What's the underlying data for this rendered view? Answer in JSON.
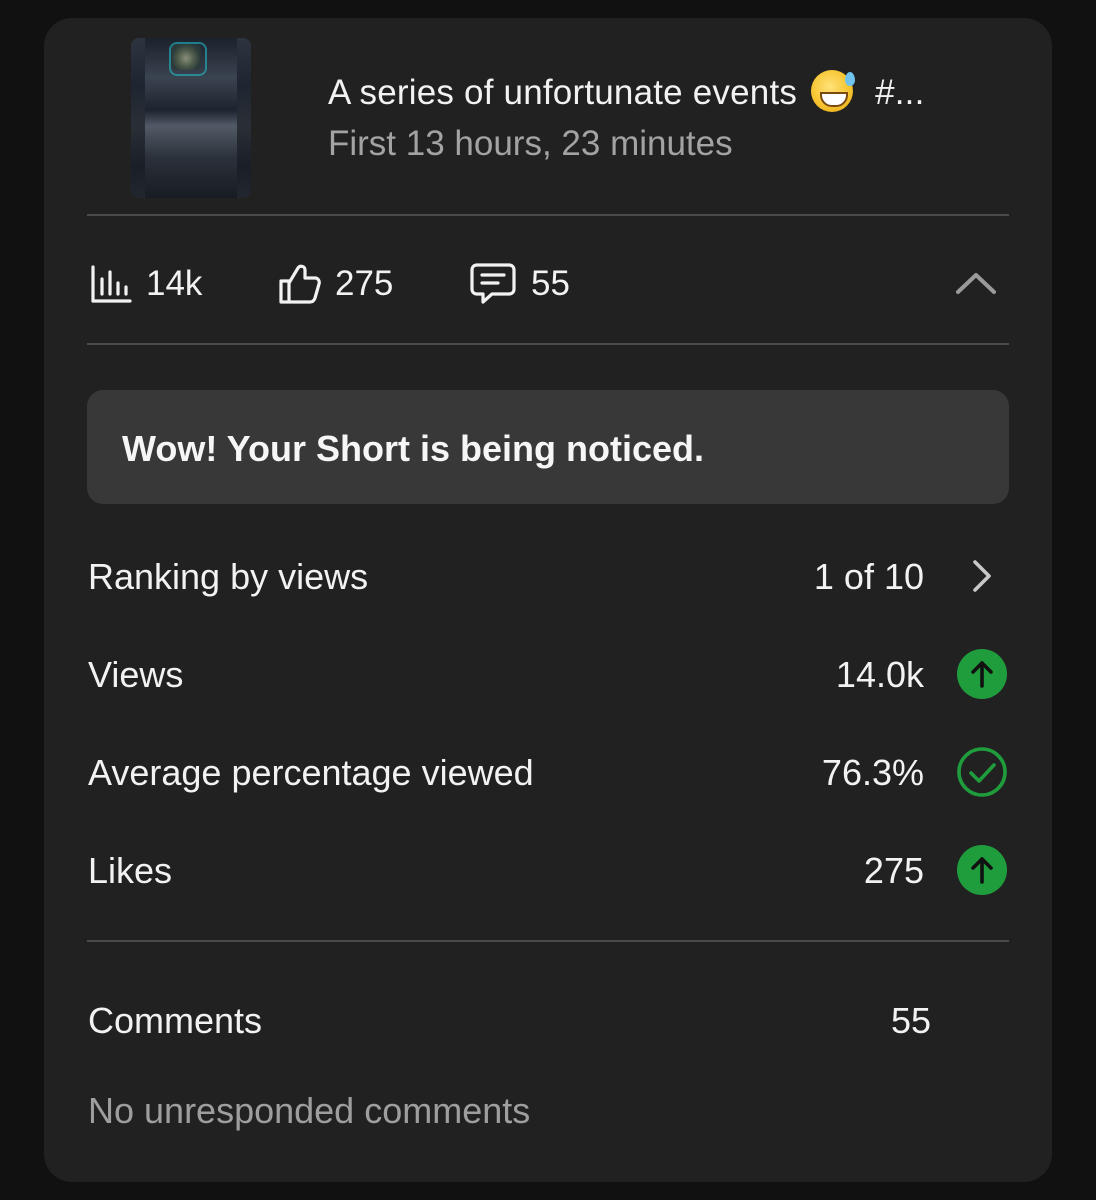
{
  "video": {
    "title": "A series of unfortunate events",
    "title_tail": "#...",
    "emoji": "grinning-face-with-sweat",
    "period": "First 13 hours, 23 minutes"
  },
  "summary": {
    "views": "14k",
    "likes": "275",
    "comments": "55"
  },
  "banner": {
    "text": "Wow! Your Short is being noticed."
  },
  "metrics": [
    {
      "label": "Ranking by views",
      "value": "1 of 10",
      "icon": "chevron-right-icon"
    },
    {
      "label": "Views",
      "value": "14.0k",
      "icon": "arrow-up-circle-icon"
    },
    {
      "label": "Average percentage viewed",
      "value": "76.3%",
      "icon": "check-circle-icon"
    },
    {
      "label": "Likes",
      "value": "275",
      "icon": "arrow-up-circle-icon"
    }
  ],
  "comments_section": {
    "label": "Comments",
    "value": "55",
    "status": "No unresponded comments"
  },
  "colors": {
    "background": "#111111",
    "card": "#212121",
    "banner": "#383838",
    "positive": "#1f9d3c",
    "text": "#f2f2f2",
    "muted": "#a3a3a3"
  }
}
